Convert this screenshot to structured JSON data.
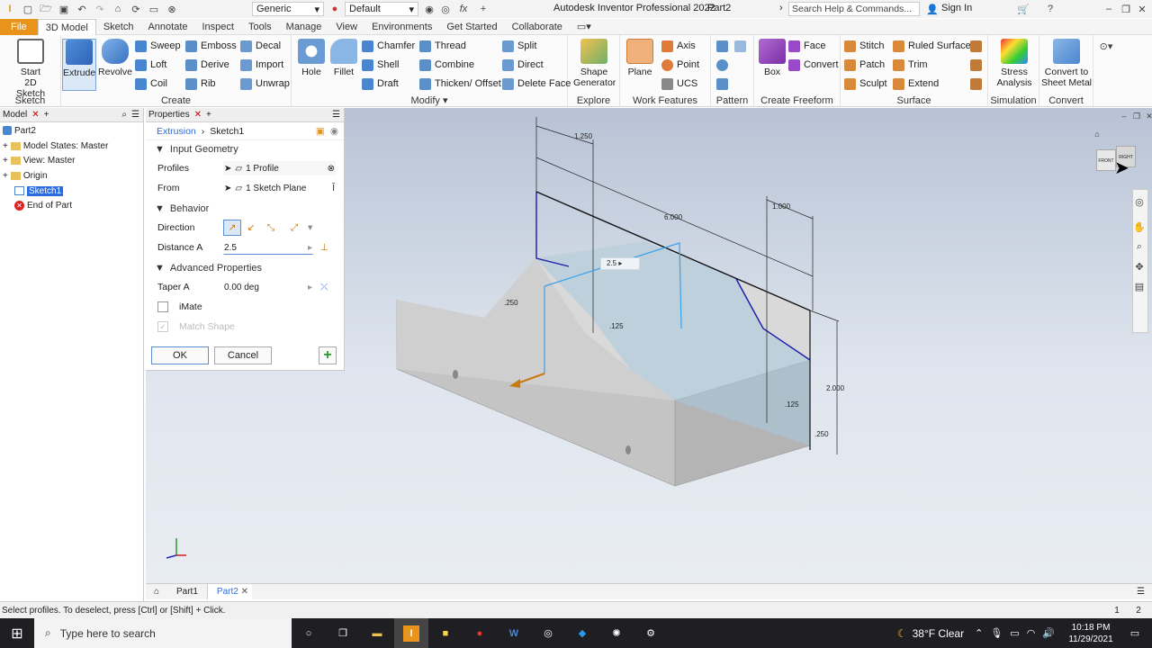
{
  "titlebar": {
    "appearance": "Generic",
    "material": "Default",
    "app_title": "Autodesk Inventor Professional 2022",
    "doc_name": "Part2",
    "search_placeholder": "Search Help & Commands...",
    "signin": "Sign In"
  },
  "menu_tabs": [
    "File",
    "3D Model",
    "Sketch",
    "Annotate",
    "Inspect",
    "Tools",
    "Manage",
    "View",
    "Environments",
    "Get Started",
    "Collaborate"
  ],
  "ribbon": {
    "sketch": {
      "start_line1": "Start",
      "start_line2": "2D Sketch",
      "label": "Sketch"
    },
    "create": {
      "extrude": "Extrude",
      "revolve": "Revolve",
      "sweep": "Sweep",
      "emboss": "Emboss",
      "decal": "Decal",
      "loft": "Loft",
      "derive": "Derive",
      "import": "Import",
      "coil": "Coil",
      "rib": "Rib",
      "unwrap": "Unwrap",
      "label": "Create"
    },
    "modify": {
      "hole": "Hole",
      "fillet": "Fillet",
      "chamfer": "Chamfer",
      "thread": "Thread",
      "split": "Split",
      "shell": "Shell",
      "combine": "Combine",
      "direct": "Direct",
      "draft": "Draft",
      "thicken": "Thicken/ Offset",
      "delete_face": "Delete Face",
      "label": "Modify"
    },
    "explore": {
      "line1": "Shape",
      "line2": "Generator",
      "label": "Explore"
    },
    "work_features": {
      "plane": "Plane",
      "axis": "Axis",
      "point": "Point",
      "ucs": "UCS",
      "label": "Work Features"
    },
    "pattern": {
      "label": "Pattern"
    },
    "freeform": {
      "box": "Box",
      "face": "Face",
      "convert": "Convert",
      "label": "Create Freeform"
    },
    "surface": {
      "stitch": "Stitch",
      "ruled": "Ruled Surface",
      "patch": "Patch",
      "trim": "Trim",
      "sculpt": "Sculpt",
      "extend": "Extend",
      "label": "Surface"
    },
    "simulation": {
      "line1": "Stress",
      "line2": "Analysis",
      "label": "Simulation"
    },
    "convert": {
      "line1": "Convert to",
      "line2": "Sheet Metal",
      "label": "Convert"
    }
  },
  "browser": {
    "tab_label": "Model",
    "items": [
      {
        "label": "Part2",
        "indent": 0
      },
      {
        "label": "Model States: Master",
        "indent": 1
      },
      {
        "label": "View: Master",
        "indent": 1
      },
      {
        "label": "Origin",
        "indent": 1
      },
      {
        "label": "Sketch1",
        "indent": 1
      },
      {
        "label": "End of Part",
        "indent": 1
      }
    ]
  },
  "properties": {
    "tab_label": "Properties",
    "breadcrumb_feature": "Extrusion",
    "breadcrumb_sketch": "Sketch1",
    "input_geometry": "Input Geometry",
    "profiles_label": "Profiles",
    "profiles_value": "1 Profile",
    "from_label": "From",
    "from_value": "1 Sketch Plane",
    "behavior": "Behavior",
    "direction_label": "Direction",
    "distance_label": "Distance A",
    "distance_value": "2.5",
    "advanced": "Advanced Properties",
    "taper_label": "Taper A",
    "taper_value": "0.00 deg",
    "imate": "iMate",
    "match_shape": "Match Shape",
    "ok": "OK",
    "cancel": "Cancel"
  },
  "viewport": {
    "dims": {
      "d1": "1.250",
      "d2": "6.000",
      "d3": "1.000",
      "d4": "2.000",
      "d5": ".125",
      "d6": ".125",
      "d7": ".250",
      "d8": ".250",
      "d9": "2.5"
    },
    "viewcube_front": "FRONT",
    "viewcube_right": "RIGHT"
  },
  "doc_tabs": [
    "Part1",
    "Part2"
  ],
  "status": {
    "text": "Select profiles. To deselect, press [Ctrl] or [Shift] + Click.",
    "n1": "1",
    "n2": "2"
  },
  "taskbar": {
    "search_placeholder": "Type here to search",
    "weather": "38°F  Clear",
    "time": "10:18 PM",
    "date": "11/29/2021"
  },
  "colors": {
    "accent": "#e8941a",
    "selection": "#2d6cdf",
    "sketch": "#1a1aa8"
  }
}
